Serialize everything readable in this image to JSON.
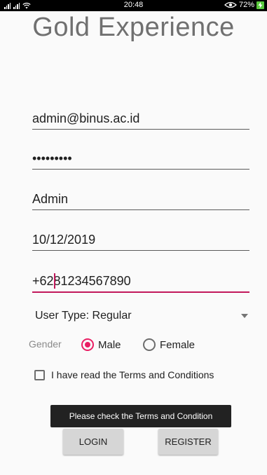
{
  "status_bar": {
    "time": "20:48",
    "battery": "72%"
  },
  "app": {
    "title": "Gold Experience"
  },
  "form": {
    "email": "admin@binus.ac.id",
    "password": "password1",
    "name": "Admin",
    "date": "10/12/2019",
    "phone": "+6281234567890",
    "user_type": "User Type: Regular",
    "gender_label": "Gender",
    "gender_options": [
      "Male",
      "Female"
    ],
    "gender_selected": "Male",
    "terms_label": "I have read the Terms and Conditions",
    "terms_checked": false
  },
  "toast": {
    "message": "Please check the Terms and Condition"
  },
  "buttons": {
    "login": "LOGIN",
    "register": "REGISTER"
  },
  "colors": {
    "accent": "#e91e63",
    "focus_underline": "#c2185b",
    "title": "#707070",
    "button_bg": "#d6d6d6",
    "toast_bg": "#222222",
    "battery": "#5ac83c"
  }
}
